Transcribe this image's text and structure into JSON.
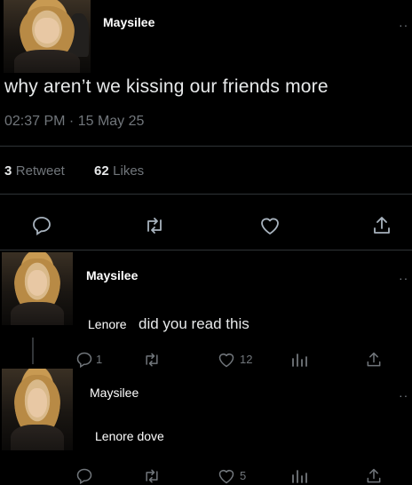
{
  "tweet": {
    "author": "Maysilee",
    "text": "why aren’t we kissing our friends more",
    "timestamp": "02:37 PM · 15 May 25",
    "retweets_count": "3",
    "retweets_label": "Retweet",
    "likes_count": "62",
    "likes_label": "Likes",
    "more_icon": "more-dots-icon"
  },
  "replies": [
    {
      "author": "Maysilee",
      "mention": "Lenore",
      "text": "did you read this",
      "reply_count": "1",
      "like_count": "12"
    },
    {
      "author": "Maysilee",
      "text": "Lenore dove",
      "reply_count": "",
      "like_count": "5"
    }
  ],
  "icons": {
    "reply": "reply-icon",
    "retweet": "retweet-icon",
    "like": "heart-icon",
    "share": "share-icon",
    "views": "analytics-icon"
  },
  "colors": {
    "background": "#000000",
    "text": "#e7e9ea",
    "muted": "#71767b",
    "divider": "#2f3336"
  }
}
